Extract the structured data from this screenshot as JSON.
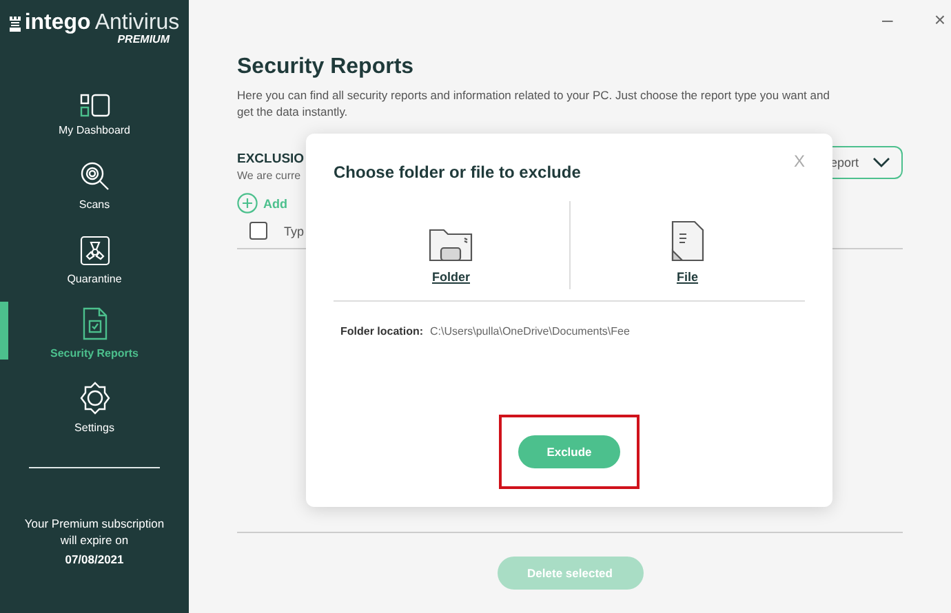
{
  "window": {
    "controls": [
      "–",
      "×"
    ]
  },
  "logo": {
    "brand": "intego",
    "product": "Antivirus",
    "edition": "PREMIUM"
  },
  "sidebar": {
    "items": [
      {
        "label": "My Dashboard",
        "kind": "dashboard",
        "selected": false
      },
      {
        "label": "Scans",
        "kind": "scans",
        "selected": false
      },
      {
        "label": "Quarantine",
        "kind": "quarantine",
        "selected": false
      },
      {
        "label": "Security Reports",
        "kind": "reports",
        "selected": true
      },
      {
        "label": "Settings",
        "kind": "settings",
        "selected": false
      }
    ],
    "subscription": {
      "text": "Your Premium subscription will expire on",
      "date": "07/08/2021"
    }
  },
  "page": {
    "title": "Security Reports",
    "description": "Here you can find all security reports and information related to your PC. Just choose the report type you want and get the data instantly.",
    "section": {
      "title": "EXCLUSIO",
      "subtitle": "We are curre",
      "add": "Add",
      "report_dropdown": "eport",
      "table": {
        "select_all_checked": false,
        "columns": [
          "Typ"
        ]
      }
    },
    "delete_button": {
      "label": "Delete selected",
      "disabled": true
    }
  },
  "dialog": {
    "title": "Choose folder or file to exclude",
    "close": "X",
    "options": [
      {
        "kind": "folder",
        "label": "Folder"
      },
      {
        "kind": "file",
        "label": "File"
      }
    ],
    "location_label": "Folder location:",
    "location_value": "C:\\Users\\pulla\\OneDrive\\Documents\\Fee",
    "button": "Exclude",
    "highlighted": true
  }
}
